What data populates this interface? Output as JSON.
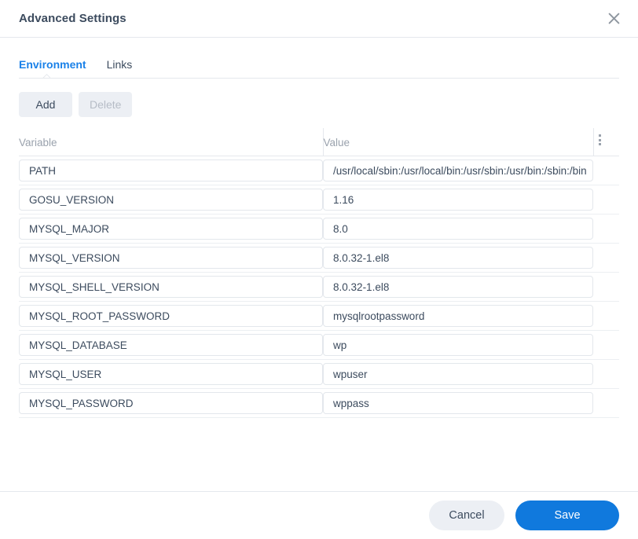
{
  "dialog": {
    "title": "Advanced Settings",
    "close_icon": "close-icon"
  },
  "tabs": [
    {
      "label": "Environment",
      "active": true
    },
    {
      "label": "Links",
      "active": false
    }
  ],
  "toolbar": {
    "add_label": "Add",
    "delete_label": "Delete",
    "delete_disabled": true
  },
  "table": {
    "columns": [
      "Variable",
      "Value"
    ],
    "menu_icon": "kebab-menu-icon",
    "rows": [
      {
        "variable": "PATH",
        "value": "/usr/local/sbin:/usr/local/bin:/usr/sbin:/usr/bin:/sbin:/bin"
      },
      {
        "variable": "GOSU_VERSION",
        "value": "1.16"
      },
      {
        "variable": "MYSQL_MAJOR",
        "value": "8.0"
      },
      {
        "variable": "MYSQL_VERSION",
        "value": "8.0.32-1.el8"
      },
      {
        "variable": "MYSQL_SHELL_VERSION",
        "value": "8.0.32-1.el8"
      },
      {
        "variable": "MYSQL_ROOT_PASSWORD",
        "value": "mysqlrootpassword"
      },
      {
        "variable": "MYSQL_DATABASE",
        "value": "wp"
      },
      {
        "variable": "MYSQL_USER",
        "value": "wpuser"
      },
      {
        "variable": "MYSQL_PASSWORD",
        "value": "wppass"
      }
    ]
  },
  "footer": {
    "cancel_label": "Cancel",
    "save_label": "Save"
  },
  "colors": {
    "accent": "#1a81e8",
    "save_button": "#1079dd",
    "text": "#3c4b5e",
    "muted": "#9aa2ad",
    "border": "#e5e8ed"
  }
}
